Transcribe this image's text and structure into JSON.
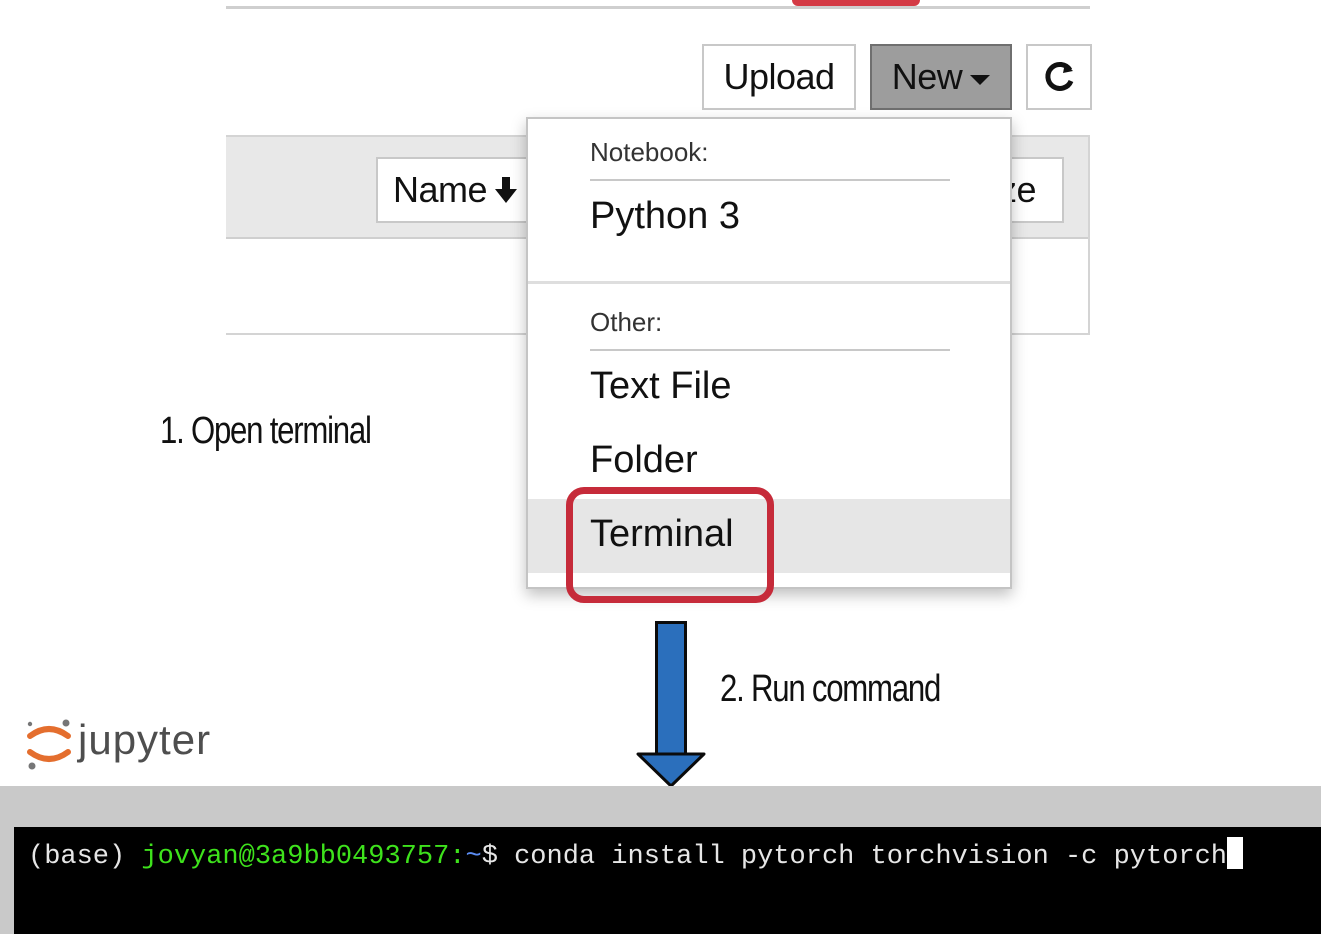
{
  "toolbar": {
    "upload_label": "Upload",
    "new_label": "New",
    "refresh_icon": "refresh-icon"
  },
  "file_list": {
    "name_header": "Name",
    "name_sort_icon": "arrow-down-icon",
    "size_header_fragment": "ze"
  },
  "new_menu": {
    "notebook_section": "Notebook:",
    "notebook_items": [
      "Python 3"
    ],
    "other_section": "Other:",
    "other_items": [
      "Text File",
      "Folder",
      "Terminal"
    ],
    "highlighted_item": "Terminal"
  },
  "annotations": {
    "step1": "1. Open terminal",
    "step2": "2. Run command",
    "highlight_color": "#c62b3a",
    "arrow_color": "#2b6fbc"
  },
  "branding": {
    "logo_text": "jupyter"
  },
  "terminal": {
    "env": "(base)",
    "user_host": "jovyan@3a9bb0493757",
    "path_sep": ":",
    "cwd": "~",
    "prompt": "$",
    "command": "conda install pytorch torchvision -c pytorch"
  }
}
